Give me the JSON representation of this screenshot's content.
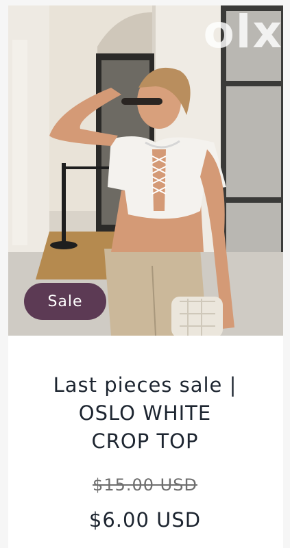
{
  "product": {
    "badge": "Sale",
    "title_lines": [
      "Last pieces sale |",
      "OSLO WHITE",
      "CROP TOP"
    ],
    "compare_price": "$15.00 USD",
    "price": "$6.00 USD",
    "image_alt": "Model wearing white lace-up crop top with beige trousers",
    "watermark": "olx"
  },
  "colors": {
    "badge_bg": "#5c3a54",
    "text": "#1d2530",
    "old_price": "#6e6e6e"
  }
}
